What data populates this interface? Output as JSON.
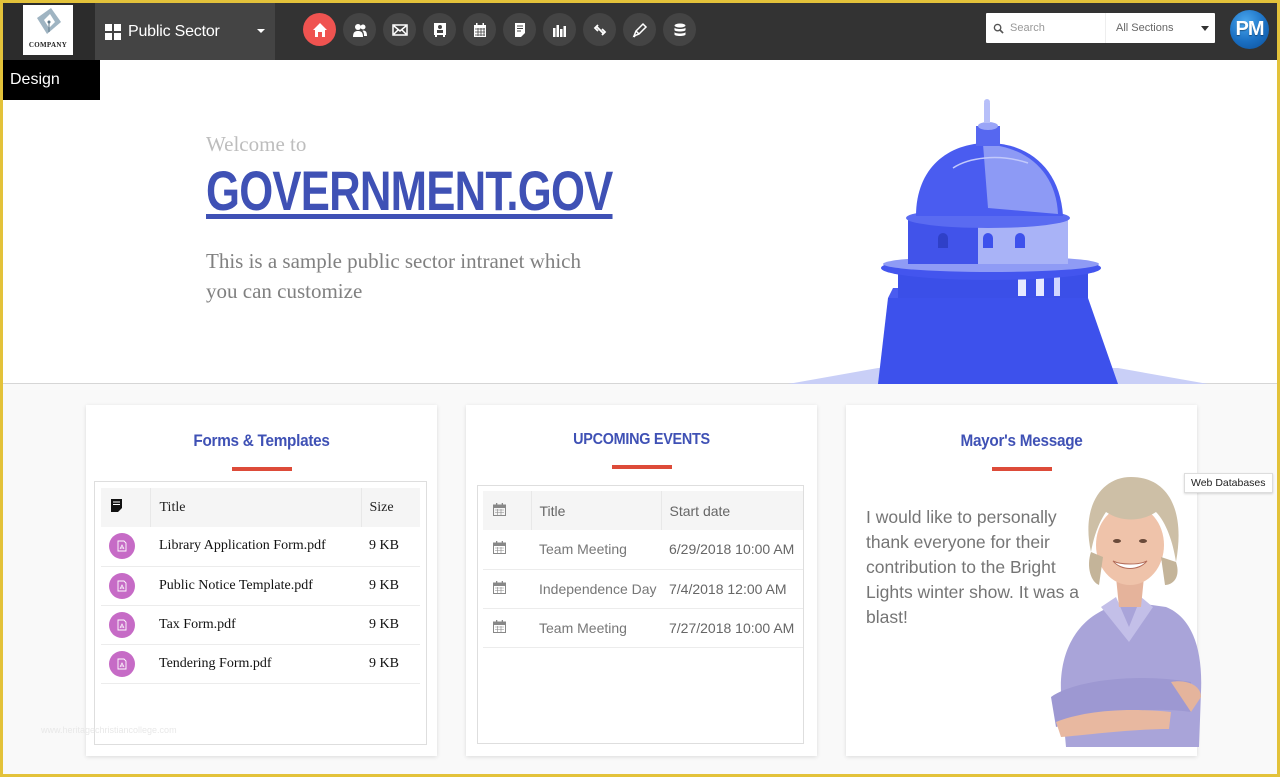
{
  "navbar": {
    "logo_text": "COMPANY",
    "site_switcher": {
      "label": "Public Sector"
    },
    "nav_icons": [
      {
        "name": "home-icon",
        "active": true
      },
      {
        "name": "people-icon",
        "active": false
      },
      {
        "name": "mail-icon",
        "active": false
      },
      {
        "name": "contact-card-icon",
        "active": false
      },
      {
        "name": "calendar-icon",
        "active": false
      },
      {
        "name": "document-icon",
        "active": false
      },
      {
        "name": "bar-chart-icon",
        "active": false
      },
      {
        "name": "link-icon",
        "active": false
      },
      {
        "name": "pen-icon",
        "active": false
      },
      {
        "name": "database-icon",
        "active": false
      }
    ],
    "search": {
      "placeholder": "Search",
      "value": ""
    },
    "sections_select": {
      "selected": "All Sections"
    },
    "avatar_initials": "PM"
  },
  "design_tab": "Design",
  "hero": {
    "welcome": "Welcome to",
    "title": "GOVERNMENT.GOV",
    "subtitle": "This is a sample public sector intranet which you can customize"
  },
  "forms_card": {
    "title": "Forms & Templates",
    "columns": [
      "",
      "Title",
      "Size"
    ],
    "rows": [
      {
        "title": "Library Application Form.pdf",
        "size": "9 KB"
      },
      {
        "title": "Public Notice Template.pdf",
        "size": "9 KB"
      },
      {
        "title": "Tax Form.pdf",
        "size": "9 KB"
      },
      {
        "title": "Tendering Form.pdf",
        "size": "9 KB"
      }
    ]
  },
  "events_card": {
    "title": "UPCOMING EVENTS",
    "columns": [
      "",
      "Title",
      "Start date"
    ],
    "rows": [
      {
        "title": "Team Meeting",
        "start": "6/29/2018 10:00 AM"
      },
      {
        "title": "Independence Day",
        "start": "7/4/2018 12:00 AM"
      },
      {
        "title": "Team Meeting",
        "start": "7/27/2018 10:00 AM"
      }
    ]
  },
  "mayor_card": {
    "title": "Mayor's Message",
    "message": "I would like to personally thank everyone for their contribution to the Bright Lights winter show. It was a blast!"
  },
  "tooltip": "Web Databases",
  "watermark": "www.heritagechristiancollege.com",
  "colors": {
    "accent_blue": "#3f51b5",
    "accent_red": "#dd4b39",
    "home_active": "#ef5350",
    "pdf_badge": "#c66bc6",
    "navbar_bg": "#333333"
  }
}
